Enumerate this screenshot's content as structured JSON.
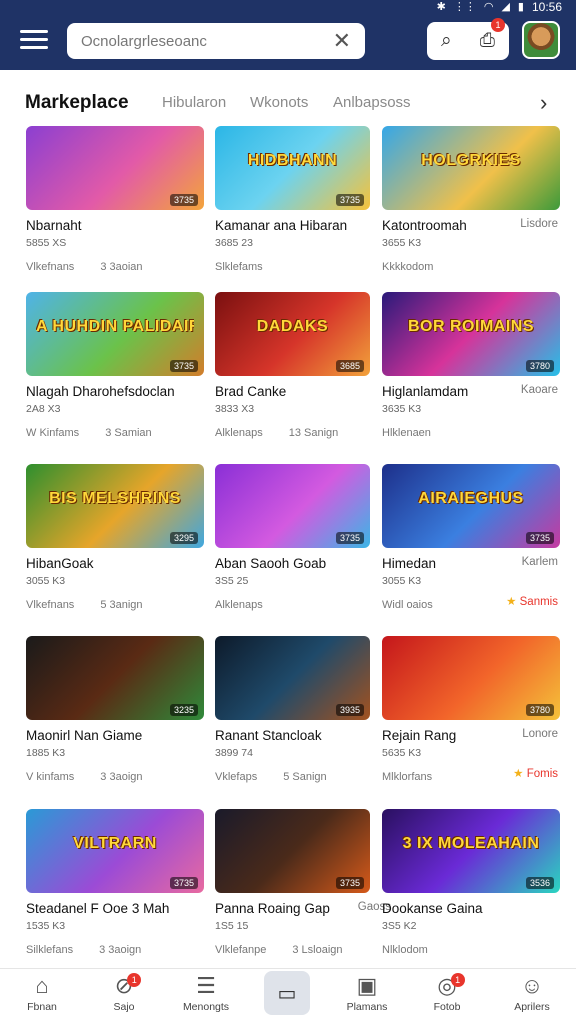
{
  "status": {
    "time": "10:56",
    "icons": [
      "bluetooth-icon",
      "vibrate-icon",
      "wifi-icon",
      "signal-icon",
      "battery-icon"
    ]
  },
  "header": {
    "search_placeholder": "Ocnolargrleseoanc",
    "notification_count": "1"
  },
  "tabs": {
    "active": "Markeplace",
    "items": [
      "Hibularon",
      "Wkonots",
      "Anlbapsoss"
    ]
  },
  "cards": [
    {
      "title": "Nbarnaht",
      "sub": "5855 XS",
      "meta1": "Vlkefnans",
      "meta2": "3 3aoian",
      "side": "",
      "thumb_text": "",
      "pill": "3735"
    },
    {
      "title": "Kamanar ana Hibaran",
      "sub": "3685 23",
      "meta1": "Slklefams",
      "meta2": "",
      "side": "",
      "thumb_text": "HIDBHANN",
      "pill": "3735"
    },
    {
      "title": "Katontroomah",
      "sub": "3655 K3",
      "meta1": "Kkkkodom",
      "meta2": "",
      "side": "Lisdore",
      "thumb_text": "HOLGRKIES",
      "pill": ""
    },
    {
      "title": "Nlagah Dharohefsdoclan",
      "sub": "2A8 X3",
      "meta1": "W Kinfams",
      "meta2": "3 Samian",
      "side": "",
      "thumb_text": "A HUHDIN PALIDAIRS",
      "pill": "3735"
    },
    {
      "title": "Brad Canke",
      "sub": "3833 X3",
      "meta1": "Alklenaps",
      "meta2": "13 Sanign",
      "side": "",
      "thumb_text": "DADAKS",
      "pill": "3685"
    },
    {
      "title": "Higlanlamdam",
      "sub": "3635 K3",
      "meta1": "Hlklenaen",
      "meta2": "",
      "side": "Kaoare",
      "thumb_text": "BOR ROIMAINS",
      "pill": "3780"
    },
    {
      "title": "HibanGoak",
      "sub": "3055 K3",
      "meta1": "Vlkefnans",
      "meta2": "5 3anign",
      "side": "",
      "thumb_text": "BIS MELSHRINS",
      "pill": "3295"
    },
    {
      "title": "Aban Saooh Goab",
      "sub": "3S5 25",
      "meta1": "Alklenaps",
      "meta2": "",
      "side": "",
      "thumb_text": "",
      "pill": "3735"
    },
    {
      "title": "Himedan",
      "sub": "3055 K3",
      "meta1": "Widl oaios",
      "meta2": "",
      "side": "Karlem",
      "star": "Sanmis",
      "thumb_text": "AIRAIEGHUS",
      "pill": "3735"
    },
    {
      "title": "Maonirl Nan Giame",
      "sub": "1885 K3",
      "meta1": "V kinfams",
      "meta2": "3 3aoign",
      "side": "",
      "thumb_text": "",
      "pill": "3235"
    },
    {
      "title": "Ranant Stancloak",
      "sub": "3899 74",
      "meta1": "Vklefaps",
      "meta2": "5 Sanign",
      "side": "",
      "thumb_text": "",
      "pill": "3935"
    },
    {
      "title": "Rejain Rang",
      "sub": "5635 K3",
      "meta1": "Mlklorfans",
      "meta2": "",
      "side": "Lonore",
      "star": "Fomis",
      "thumb_text": "",
      "pill": "3780"
    },
    {
      "title": "Steadanel F Ooe 3 Mah",
      "sub": "1535 K3",
      "meta1": "Silklefans",
      "meta2": "3 3aoign",
      "side": "",
      "thumb_text": "VILTRARN",
      "pill": "3735"
    },
    {
      "title": "Panna Roaing Gap",
      "sub": "1S5 15",
      "meta1": "Vlklefanpe",
      "meta2": "3 Lsloaign",
      "side": "Gaoss",
      "thumb_text": "",
      "pill": "3735"
    },
    {
      "title": "Dookanse Gaina",
      "sub": "3S5 K2",
      "meta1": "Nlklodom",
      "meta2": "",
      "side": "",
      "thumb_text": "3 IX MOLEAHAIN",
      "pill": "3536"
    }
  ],
  "bottom_nav": [
    {
      "label": "Fbnan",
      "icon": "home-icon",
      "badge": ""
    },
    {
      "label": "Sajo",
      "icon": "discover-icon",
      "badge": "1"
    },
    {
      "label": "Menongts",
      "icon": "layers-icon",
      "badge": ""
    },
    {
      "label": "",
      "icon": "chat-icon",
      "badge": ""
    },
    {
      "label": "Plamans",
      "icon": "calendar-icon",
      "badge": ""
    },
    {
      "label": "Fotob",
      "icon": "compass-icon",
      "badge": "1"
    },
    {
      "label": "Aprilers",
      "icon": "user-icon",
      "badge": ""
    }
  ]
}
